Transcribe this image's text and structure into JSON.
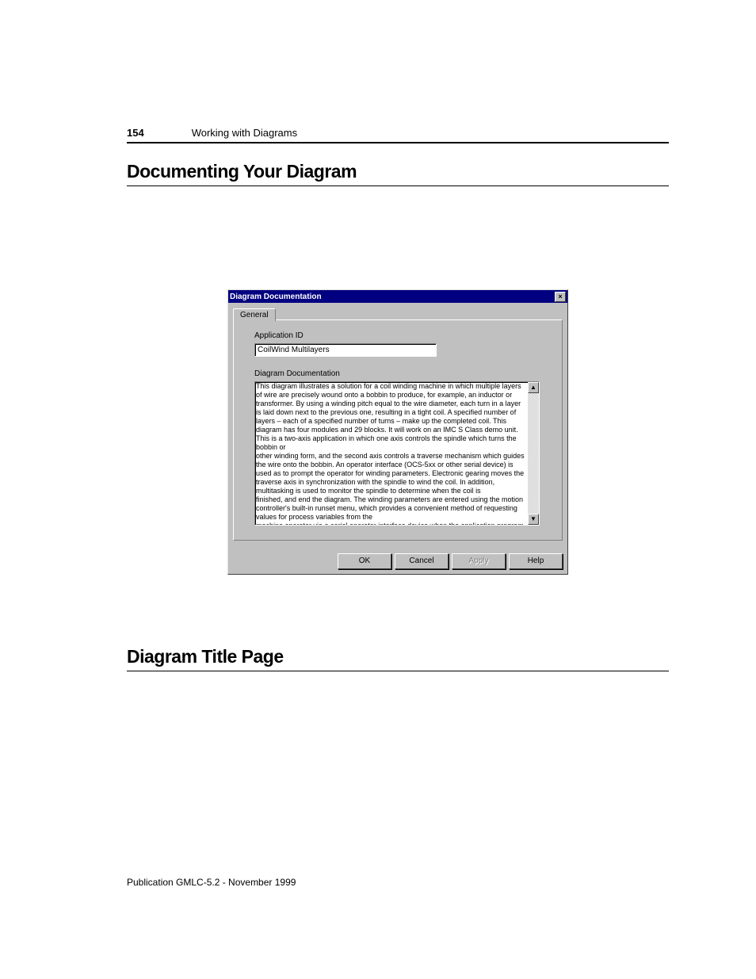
{
  "page_number": "154",
  "chapter_title": "Working with Diagrams",
  "heading1": "Documenting Your Diagram",
  "heading2": "Diagram Title Page",
  "footer": "Publication GMLC-5.2 - November 1999",
  "dialog": {
    "title": "Diagram Documentation",
    "close_label": "×",
    "tab_label": "General",
    "app_id_label": "Application ID",
    "app_id_value": "CoilWind Multilayers",
    "doc_label": "Diagram Documentation",
    "doc_text_p1": "This diagram illustrates a solution for a coil winding machine in which multiple layers of wire are precisely wound onto a bobbin to produce, for example, an inductor or transformer. By using a winding pitch equal to the wire diameter, each turn in a layer is laid down next to the previous one, resulting in a tight coil. A specified number of layers – each of a specified number of turns – make up the completed coil. This diagram has four modules and 29 blocks. It will work on an IMC S Class demo unit. This is a two-axis application in which one axis controls the spindle which turns the bobbin or",
    "doc_text_p2": "other winding form, and the second axis controls a traverse mechanism which guides the wire onto the bobbin. An operator interface (OCS-5xx or other serial device) is used as to prompt the operator for winding parameters. Electronic gearing moves the traverse axis in synchronization with the spindle to wind the coil. In addition, multitasking is used to monitor the spindle to determine when the coil is",
    "doc_text_p3": "finished, and end the diagram. The winding parameters are entered using the motion controller's built-in runset menu, which provides a convenient method of requesting values for process variables from the",
    "doc_text_p4": "machine operator via a serial operator interface device when the application program (generated from the GML diagram) is run. The runset menu is configured using Runset Menu Items in the",
    "scroll_up": "▲",
    "scroll_down": "▼",
    "buttons": {
      "ok": "OK",
      "cancel": "Cancel",
      "apply": "Apply",
      "help": "Help"
    }
  }
}
